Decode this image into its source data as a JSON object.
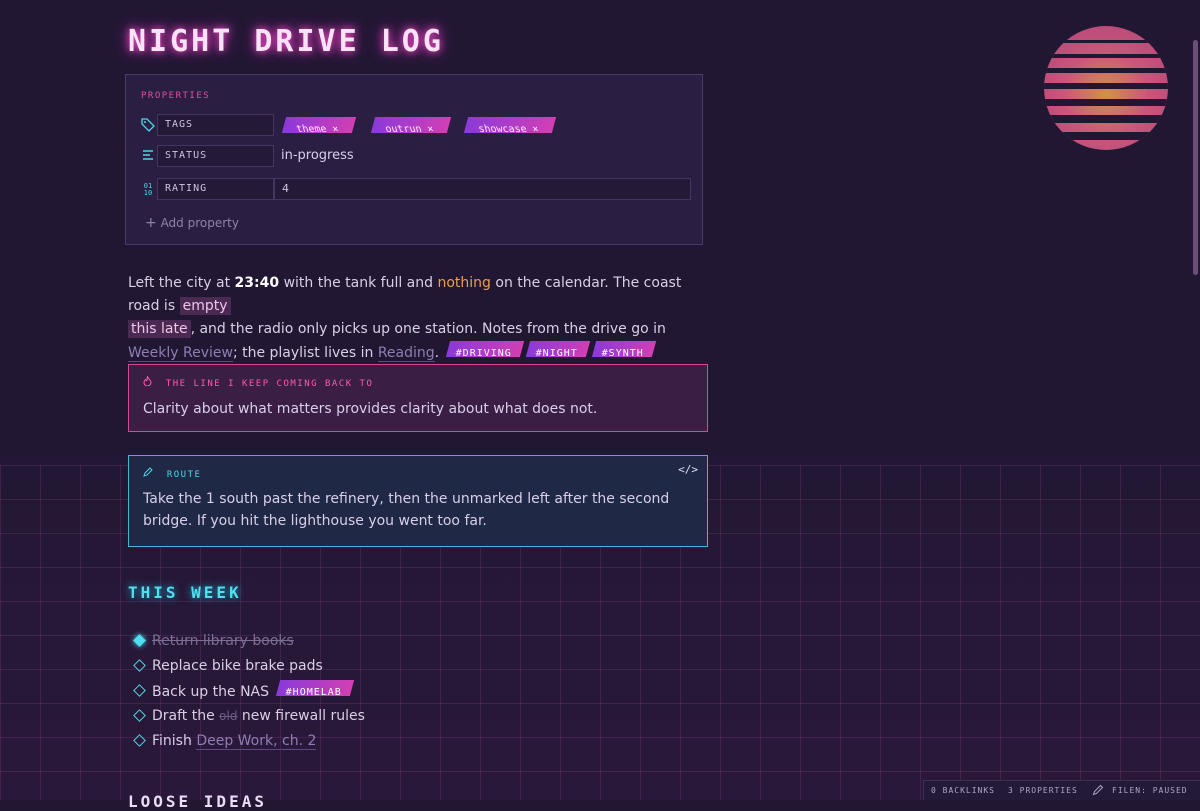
{
  "title": "NIGHT DRIVE LOG",
  "properties": {
    "header": "PROPERTIES",
    "tags_key": "TAGS",
    "tags": [
      {
        "label": "theme",
        "remove": "×"
      },
      {
        "label": "outrun",
        "remove": "×"
      },
      {
        "label": "showcase",
        "remove": "×"
      }
    ],
    "status_key": "STATUS",
    "status_value": "in-progress",
    "rating_key": "RATING",
    "rating_value": "4",
    "add_label": "Add property"
  },
  "paragraph": {
    "p1": "Left the city at ",
    "time": "23:40",
    "p2": " with the tank full and ",
    "orange": "nothing",
    "p3": " on the calendar. The coast road is ",
    "highlight1": "empty",
    "highlight2": "this late",
    "p4": ", and the radio only picks up one station. Notes from the drive go in ",
    "link1": "Weekly Review",
    "p5": "; the playlist lives in ",
    "link2": "Reading",
    "p6": ".",
    "tags": [
      "#DRIVING",
      "#NIGHT",
      "#SYNTH"
    ]
  },
  "quote_callout": {
    "heading": "THE LINE I KEEP COMING BACK TO",
    "body": "Clarity about what matters provides clarity about what does not."
  },
  "route_callout": {
    "heading": "ROUTE",
    "body": "Take the 1 south past the refinery, then the unmarked left after the second bridge. If you hit the lighthouse you went too far.",
    "code_toggle": "</>"
  },
  "this_week": {
    "heading": "THIS WEEK",
    "tasks": [
      {
        "text": "Return library books",
        "done": true
      },
      {
        "text": "Replace bike brake pads"
      },
      {
        "text": "Back up the NAS",
        "tag": "#HOMELAB"
      },
      {
        "pre": "Draft the ",
        "struck": "old",
        "post": " new firewall rules"
      },
      {
        "pre": "Finish ",
        "link": "Deep Work, ch. 2"
      }
    ]
  },
  "next_heading": "LOOSE IDEAS",
  "status_bar": {
    "backlinks": "0 BACKLINKS",
    "properties": "3 PROPERTIES",
    "mode": "FILEN: PAUSED"
  },
  "colors": {
    "accent_pink": "#ff4fd1",
    "accent_cyan": "#4fe0f0",
    "background": "#211733"
  }
}
